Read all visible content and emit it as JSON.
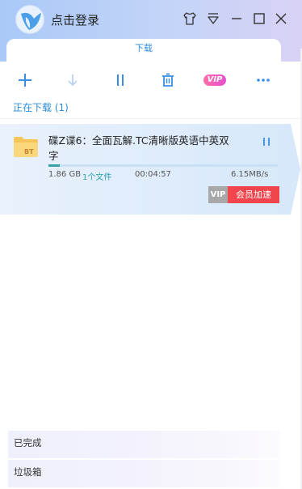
{
  "header": {
    "login_text": "点击登录"
  },
  "tabs": {
    "active_label": "下载"
  },
  "toolbar": {
    "vip_label": "VIP",
    "icons": [
      "plus-icon",
      "download-icon",
      "pause-icon",
      "trash-icon",
      "vip-icon",
      "more-icon"
    ]
  },
  "downloading": {
    "section_title": "正在下载 (1)",
    "item": {
      "badge": "BT",
      "name": "碟Z谍6：全面瓦解.TC清晰版英语中英双字",
      "size": "1.86 GB",
      "files": "1个文件",
      "elapsed": "00:04:57",
      "speed": "6.15MB/s",
      "progress": 0.05,
      "vip_tag": "VIP",
      "accelerate_label": "会员加速"
    }
  },
  "sections": {
    "completed": "已完成",
    "trash": "垃圾箱"
  },
  "colors": {
    "accent": "#2b8bd6",
    "accelerate": "#f2444d",
    "progress": "#3aa0a8"
  }
}
